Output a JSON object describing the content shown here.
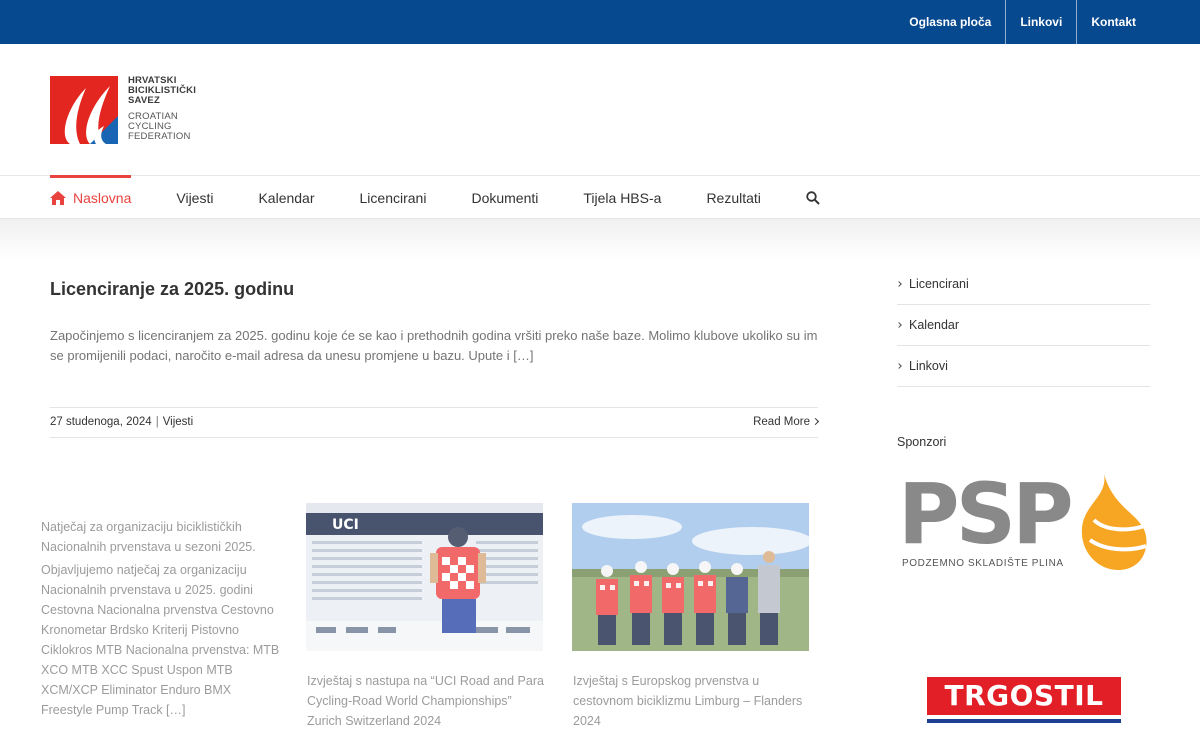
{
  "topnav": {
    "items": [
      "Oglasna ploča",
      "Linkovi",
      "Kontakt"
    ]
  },
  "logo": {
    "line1": "HRVATSKI",
    "line2": "BICIKLISTIČKI",
    "line3": "SAVEZ",
    "line4": "CROATIAN",
    "line5": "CYCLING",
    "line6": "FEDERATION"
  },
  "mainnav": {
    "items": [
      "Naslovna",
      "Vijesti",
      "Kalendar",
      "Licencirani",
      "Dokumenti",
      "Tijela HBS-a",
      "Rezultati"
    ]
  },
  "post": {
    "title": "Licenciranje za 2025. godinu",
    "excerpt": "Započinjemo s licenciranjem za 2025. godinu koje će se kao i prethodnih godina vršiti preko naše baze. Molimo klubove ukoliko su im se promijenili podaci, naročito e-mail adresa da unesu promjene u bazu. Upute i […]",
    "date": "27 studenoga, 2024",
    "category": "Vijesti",
    "read_more": "Read More"
  },
  "cards": [
    {
      "title": "Natječaj za organizaciju biciklističkih Nacionalnih prvenstava u sezoni 2025.",
      "body": "Objavljujemo natječaj za organizaciju Nacionalnih prvenstava u 2025. godini Cestovna Nacionalna prvenstva Cestovno Kronometar Brdsko Kriterij Pistovno Ciklokros MTB Nacionalna prvenstva: MTB XCO MTB XCC Spust Uspon MTB XCM/XCP Eliminator Enduro BMX Freestyle Pump Track […]"
    },
    {
      "title": "Izvještaj s nastupa na “UCI Road and Para Cycling-Road World Championships” Zurich Switzerland 2024",
      "image_text": "UCI"
    },
    {
      "title": "Izvještaj s Europskog prvenstva u cestovnom biciklizmu Limburg – Flanders 2024"
    }
  ],
  "sidebar": {
    "links": [
      "Licencirani",
      "Kalendar",
      "Linkovi"
    ],
    "sponsors_title": "Sponzori",
    "psp_word": "PSP",
    "psp_sub": "PODZEMNO SKLADIŠTE PLINA",
    "trgostil_word": "TRGOSTIL"
  },
  "colors": {
    "topbar": "#07498f",
    "accent": "#e8433f",
    "psp_gray": "#898989",
    "psp_orange": "#f6a623"
  }
}
